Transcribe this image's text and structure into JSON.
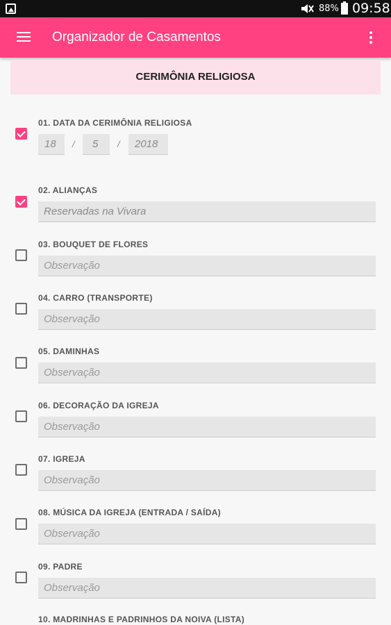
{
  "status_bar": {
    "battery": "88%",
    "time": "09:58"
  },
  "app_bar": {
    "title": "Organizador de Casamentos"
  },
  "section": {
    "title": "CERIMÔNIA RELIGIOSA"
  },
  "date_item": {
    "label": "01. DATA DA CERIMÔNIA RELIGIOSA",
    "checked": true,
    "day": "18",
    "month": "5",
    "year": "2018",
    "separator": "/"
  },
  "items": [
    {
      "label": "02. ALIANÇAS",
      "checked": true,
      "value": "Reservadas na Vivara",
      "placeholder": "Observação"
    },
    {
      "label": "03. BOUQUET DE FLORES",
      "checked": false,
      "value": "",
      "placeholder": "Observação"
    },
    {
      "label": "04. CARRO (TRANSPORTE)",
      "checked": false,
      "value": "",
      "placeholder": "Observação"
    },
    {
      "label": "05. DAMINHAS",
      "checked": false,
      "value": "",
      "placeholder": "Observação"
    },
    {
      "label": "06. DECORAÇÃO DA IGREJA",
      "checked": false,
      "value": "",
      "placeholder": "Observação"
    },
    {
      "label": "07. IGREJA",
      "checked": false,
      "value": "",
      "placeholder": "Observação"
    },
    {
      "label": "08. MÚSICA DA IGREJA (ENTRADA / SAÍDA)",
      "checked": false,
      "value": "",
      "placeholder": "Observação"
    },
    {
      "label": "09. PADRE",
      "checked": false,
      "value": "",
      "placeholder": "Observação"
    }
  ],
  "partial_item": {
    "label": "10. MADRINHAS E PADRINHOS DA NOIVA (LISTA)"
  },
  "colors": {
    "accent": "#ff4081",
    "header_bg": "#fce1ea",
    "field_bg": "#e6e6e6",
    "status_bar": "#111111"
  }
}
